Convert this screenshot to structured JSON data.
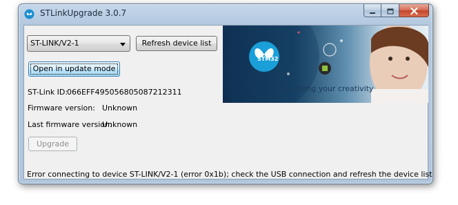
{
  "window": {
    "title": "STLinkUpgrade 3.0.7"
  },
  "device_select": {
    "selected": "ST-LINK/V2-1"
  },
  "buttons": {
    "refresh": "Refresh device list",
    "open_update": "Open in update mode",
    "upgrade": "Upgrade"
  },
  "info": {
    "stlink_id_label": "ST-Link ID:",
    "stlink_id_value": "066EFF495056805087212311",
    "firmware_label": "Firmware version:",
    "firmware_value": "Unknown",
    "last_firmware_label": "Last firmware version:",
    "last_firmware_value": "Unknown"
  },
  "banner": {
    "chip_label": "STM32",
    "tagline": "Releasing your creativity"
  },
  "status": {
    "message": "Error connecting to device ST-LINK/V2-1 (error 0x1b); check the USB connection and refresh the device list"
  },
  "icons": {
    "app": "stm-butterfly-icon",
    "minimize": "minimize-icon",
    "maximize": "maximize-icon",
    "close": "close-icon"
  },
  "colors": {
    "error_text": "#000000",
    "banner_dark": "#0e2d4e",
    "banner_accent": "#1a9fd8"
  }
}
